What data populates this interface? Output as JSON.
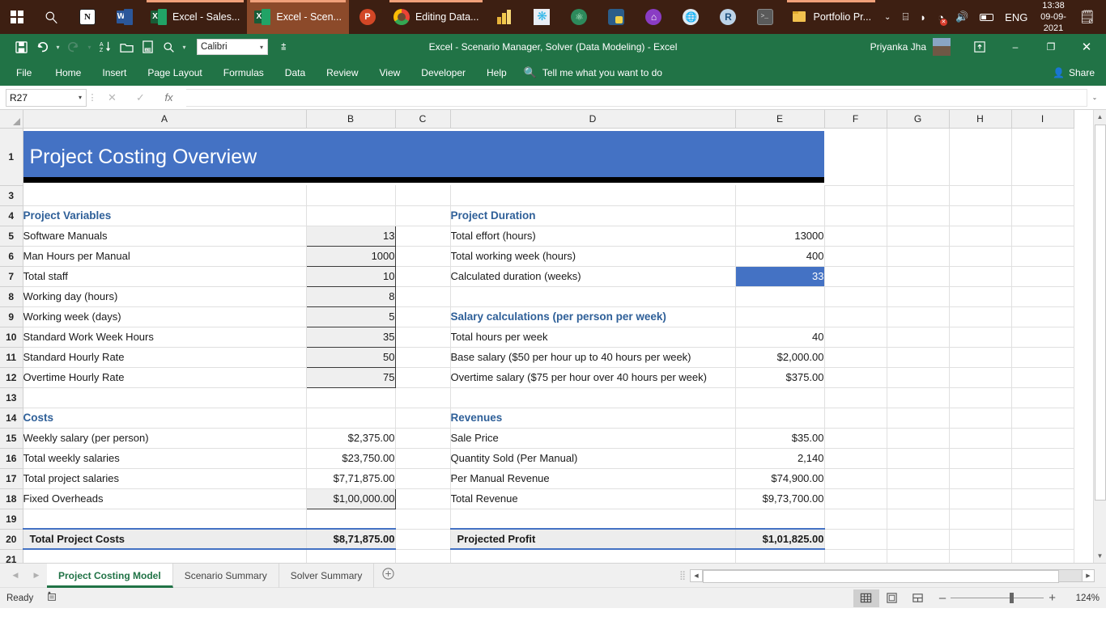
{
  "taskbar": {
    "start_icon": "windows-logo-icon",
    "search_icon": "search-icon",
    "items": [
      {
        "name": "notion",
        "icon": "notion-icon",
        "label": "",
        "active": false,
        "open": false
      },
      {
        "name": "word",
        "icon": "word-icon",
        "label": "",
        "active": false,
        "open": false
      },
      {
        "name": "excel-sales",
        "icon": "excel-icon",
        "label": "Excel - Sales...",
        "active": false,
        "open": true
      },
      {
        "name": "excel-scenario",
        "icon": "excel-icon",
        "label": "Excel - Scen...",
        "active": true,
        "open": true
      },
      {
        "name": "powerpoint",
        "icon": "powerpoint-icon",
        "label": "",
        "active": false,
        "open": false
      },
      {
        "name": "chrome-editing-data",
        "icon": "chrome-icon",
        "label": "Editing Data...",
        "active": false,
        "open": true
      },
      {
        "name": "powerbi",
        "icon": "powerbi-icon",
        "label": "",
        "active": false,
        "open": false
      },
      {
        "name": "snowflake",
        "icon": "snowflake-icon",
        "label": "",
        "active": false,
        "open": false
      },
      {
        "name": "atom",
        "icon": "atom-icon",
        "label": "",
        "active": false,
        "open": false
      },
      {
        "name": "python-app",
        "icon": "python-icon",
        "label": "",
        "active": false,
        "open": false
      },
      {
        "name": "github-desktop",
        "icon": "github-icon",
        "label": "",
        "active": false,
        "open": false
      },
      {
        "name": "browser-other",
        "icon": "globe-icon",
        "label": "",
        "active": false,
        "open": false
      },
      {
        "name": "rstudio",
        "icon": "r-icon",
        "label": "",
        "active": false,
        "open": false
      },
      {
        "name": "terminal",
        "icon": "terminal-icon",
        "label": "",
        "active": false,
        "open": false
      },
      {
        "name": "file-explorer-portfolio",
        "icon": "folder-icon",
        "label": "Portfolio Pr...",
        "active": false,
        "open": true
      }
    ],
    "tray": {
      "show_hidden": "chevron-up-icon",
      "onedrive": "onedrive-icon",
      "network": "wifi-icon",
      "volume_muted": "volume-muted-icon",
      "speaker": "speaker-icon",
      "battery": "battery-icon",
      "language": "ENG",
      "time": "13:38",
      "date": "09-09-2021",
      "action_center": "notifications-icon"
    }
  },
  "window": {
    "title": "Excel - Scenario Manager, Solver (Data Modeling)  -  Excel",
    "user": "Priyanka Jha",
    "minimize": "–",
    "restore": "❐",
    "close": "✕",
    "ribbon_display_options": "ribbon-display-icon"
  },
  "quick_access": {
    "items": [
      {
        "name": "save-button",
        "icon": "save-icon"
      },
      {
        "name": "undo-button",
        "icon": "undo-icon"
      },
      {
        "name": "redo-button",
        "icon": "redo-icon"
      },
      {
        "name": "sort-az-button",
        "icon": "sort-az-icon"
      },
      {
        "name": "open-button",
        "icon": "open-folder-icon"
      },
      {
        "name": "print-preview-button",
        "icon": "print-preview-icon"
      },
      {
        "name": "find-button",
        "icon": "search-icon"
      }
    ],
    "font_name": "Calibri",
    "customize_label": "customize-quick-access-toolbar"
  },
  "ribbon": {
    "tabs": [
      "File",
      "Home",
      "Insert",
      "Page Layout",
      "Formulas",
      "Data",
      "Review",
      "View",
      "Developer",
      "Help"
    ],
    "tellme_placeholder": "Tell me what you want to do",
    "share_label": "Share"
  },
  "formula_bar": {
    "name_box": "R27",
    "cancel": "✕",
    "enter": "✓",
    "insert_function": "fx",
    "formula_value": ""
  },
  "grid": {
    "columns": [
      "A",
      "B",
      "C",
      "D",
      "E",
      "F",
      "G",
      "H",
      "I"
    ],
    "banner": "Project Costing Overview",
    "rows": [
      {
        "n": "1",
        "banner": true
      },
      {
        "n": "3",
        "a": "",
        "b": "",
        "c": "",
        "d": "",
        "e": ""
      },
      {
        "n": "4",
        "a": "Project Variables",
        "a_style": "hdr2",
        "b": "",
        "c": "",
        "d": "Project Duration",
        "d_style": "hdr2",
        "e": ""
      },
      {
        "n": "5",
        "a": "Software Manuals",
        "b": "13",
        "b_style": "inputcell",
        "c": "",
        "d": "Total effort (hours)",
        "e": "13000"
      },
      {
        "n": "6",
        "a": "Man Hours per Manual",
        "b": "1000",
        "b_style": "inputcell",
        "c": "",
        "d": "Total working week (hours)",
        "e": "400"
      },
      {
        "n": "7",
        "a": "Total staff",
        "b": "10",
        "b_style": "inputcell",
        "c": "",
        "d": "Calculated duration (weeks)",
        "e": "33",
        "e_style": "sel"
      },
      {
        "n": "8",
        "a": "Working day (hours)",
        "b": "8",
        "b_style": "inputcell",
        "c": "",
        "d": "",
        "e": ""
      },
      {
        "n": "9",
        "a": "Working week (days)",
        "b": "5",
        "b_style": "inputcell",
        "c": "",
        "d": "Salary calculations (per person per week)",
        "d_style": "hdr2",
        "d_overflow": true,
        "e": ""
      },
      {
        "n": "10",
        "a": "Standard Work Week Hours",
        "b": "35",
        "b_style": "inputcell",
        "c": "",
        "d": "Total hours per week",
        "e": "40"
      },
      {
        "n": "11",
        "a": "Standard Hourly Rate",
        "b": "50",
        "b_style": "inputcell",
        "c": "",
        "d": "Base salary ($50 per hour up to 40 hours per week)",
        "e": "$2,000.00"
      },
      {
        "n": "12",
        "a": "Overtime Hourly Rate",
        "b": "75",
        "b_style": "inputcell",
        "c": "",
        "d": "Overtime salary ($75 per hour over 40 hours per week)",
        "e": "$375.00"
      },
      {
        "n": "13",
        "a": "",
        "b": "",
        "c": "",
        "d": "",
        "e": ""
      },
      {
        "n": "14",
        "a": "Costs",
        "a_style": "hdr2",
        "b": "",
        "c": "",
        "d": "Revenues",
        "d_style": "hdr2",
        "e": ""
      },
      {
        "n": "15",
        "a": "Weekly salary (per person)",
        "b": "$2,375.00",
        "c": "",
        "d": "Sale Price",
        "e": "$35.00"
      },
      {
        "n": "16",
        "a": "Total weekly salaries",
        "b": "$23,750.00",
        "c": "",
        "d": "Quantity Sold (Per Manual)",
        "e": "2,140"
      },
      {
        "n": "17",
        "a": "Total project salaries",
        "b": "$7,71,875.00",
        "c": "",
        "d": "Per Manual Revenue",
        "e": "$74,900.00"
      },
      {
        "n": "18",
        "a": "Fixed Overheads",
        "b": "$1,00,000.00",
        "b_style": "inputcell",
        "c": "",
        "d": "Total Revenue",
        "e": "$9,73,700.00"
      },
      {
        "n": "19",
        "a": "",
        "b": "",
        "c": "",
        "d": "",
        "e": ""
      },
      {
        "n": "20",
        "a": "Total Project Costs",
        "b": "$8,71,875.00",
        "c": "",
        "d": "Projected Profit",
        "e": "$1,01,825.00",
        "total": true
      },
      {
        "n": "21",
        "a": "",
        "b": "",
        "c": "",
        "d": "",
        "e": ""
      }
    ]
  },
  "sheet_tabs": {
    "first_arrow": "◀",
    "last_arrow": "▶",
    "tabs": [
      "Project Costing Model",
      "Scenario Summary",
      "Solver Summary"
    ],
    "active": "Project Costing Model",
    "add_sheet": "+"
  },
  "status_bar": {
    "state": "Ready",
    "accessibility_icon": "accessibility-checker-icon",
    "views": [
      {
        "name": "normal-view-button",
        "icon": "grid-icon",
        "active": true
      },
      {
        "name": "page-layout-view-button",
        "icon": "page-layout-icon",
        "active": false
      },
      {
        "name": "page-break-preview-button",
        "icon": "page-break-icon",
        "active": false
      }
    ],
    "zoom_out": "–",
    "zoom_in": "+",
    "zoom_level": "124%"
  }
}
